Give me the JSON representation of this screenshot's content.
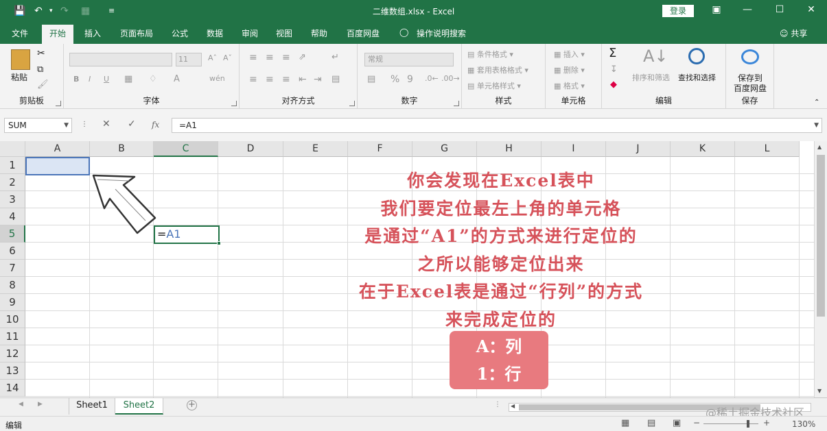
{
  "window": {
    "title": "二维数组.xlsx - Excel",
    "login_label": "登录",
    "share_label": "共享",
    "colors": {
      "brand": "#217346",
      "annotation": "#d6525a",
      "badge": "#e87a7f"
    }
  },
  "tabs": [
    "文件",
    "开始",
    "插入",
    "页面布局",
    "公式",
    "数据",
    "审阅",
    "视图",
    "帮助",
    "百度网盘",
    "操作说明搜索"
  ],
  "active_tab": "开始",
  "ribbon": {
    "clipboard": {
      "paste": "粘贴",
      "label": "剪贴板"
    },
    "font": {
      "label": "字体",
      "size": "11",
      "bold": "B",
      "italic": "I",
      "underline": "U"
    },
    "alignment": {
      "label": "对齐方式"
    },
    "number": {
      "label": "数字",
      "format": "常规",
      "percent": "%",
      "comma": "9"
    },
    "styles": {
      "label": "样式",
      "items": [
        "条件格式",
        "套用表格格式",
        "单元格样式"
      ]
    },
    "cells": {
      "label": "单元格",
      "items": [
        "插入",
        "删除",
        "格式"
      ]
    },
    "editing": {
      "label": "编辑",
      "sort": "排序和筛选",
      "find": "查找和选择"
    },
    "save": {
      "label": "保存",
      "button_line1": "保存到",
      "button_line2": "百度网盘"
    }
  },
  "formula_bar": {
    "name_box": "SUM",
    "formula": "=A1",
    "fx": "fx"
  },
  "grid": {
    "columns": [
      "A",
      "B",
      "C",
      "D",
      "E",
      "F",
      "G",
      "H",
      "I",
      "J",
      "K",
      "L"
    ],
    "rows": [
      "1",
      "2",
      "3",
      "4",
      "5",
      "6",
      "7",
      "8",
      "9",
      "10",
      "11",
      "12",
      "13",
      "14"
    ],
    "editing_cell": {
      "prefix": "=",
      "ref": "A1"
    }
  },
  "annotation": {
    "lines": [
      "你会发现在Excel表中",
      "我们要定位最左上角的单元格",
      "是通过“A1”的方式来进行定位的",
      "之所以能够定位出来",
      "在于Excel表是通过“行列”的方式",
      "来完成定位的"
    ],
    "badge": [
      "A：列",
      "1：行"
    ]
  },
  "sheets": [
    "Sheet1",
    "Sheet2"
  ],
  "active_sheet": "Sheet2",
  "status": {
    "mode": "编辑",
    "zoom": "130%"
  },
  "watermark": "@稀土掘金技术社区"
}
